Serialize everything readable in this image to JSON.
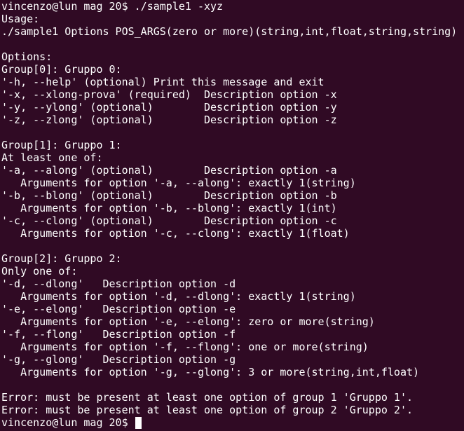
{
  "terminal": {
    "lines": [
      "vincenzo@lun mag 20$ ./sample1 -xyz",
      "Usage:",
      "./sample1 Options POS_ARGS(zero or more)(string,int,float,string,string)",
      "",
      "Options:",
      "Group[0]: Gruppo 0:",
      "'-h, --help' (optional) Print this message and exit",
      "'-x, --xlong-prova' (required)  Description option -x",
      "'-y, --ylong' (optional)        Description option -y",
      "'-z, --zlong' (optional)        Description option -z",
      "",
      "Group[1]: Gruppo 1:",
      "At least one of:",
      "'-a, --along' (optional)        Description option -a",
      "   Arguments for option '-a, --along': exactly 1(string)",
      "'-b, --blong' (optional)        Description option -b",
      "   Arguments for option '-b, --blong': exactly 1(int)",
      "'-c, --clong' (optional)        Description option -c",
      "   Arguments for option '-c, --clong': exactly 1(float)",
      "",
      "Group[2]: Gruppo 2:",
      "Only one of:",
      "'-d, --dlong'   Description option -d",
      "   Arguments for option '-d, --dlong': exactly 1(string)",
      "'-e, --elong'   Description option -e",
      "   Arguments for option '-e, --elong': zero or more(string)",
      "'-f, --flong'   Description option -f",
      "   Arguments for option '-f, --flong': one or more(string)",
      "'-g, --glong'   Description option -g",
      "   Arguments for option '-g, --glong': 3 or more(string,int,float)",
      "",
      "Error: must be present at least one option of group 1 'Gruppo 1'.",
      "Error: must be present at least one option of group 2 'Gruppo 2'."
    ],
    "prompt": "vincenzo@lun mag 20$ ",
    "colors": {
      "background": "#300a24",
      "foreground": "#ffffff"
    }
  }
}
